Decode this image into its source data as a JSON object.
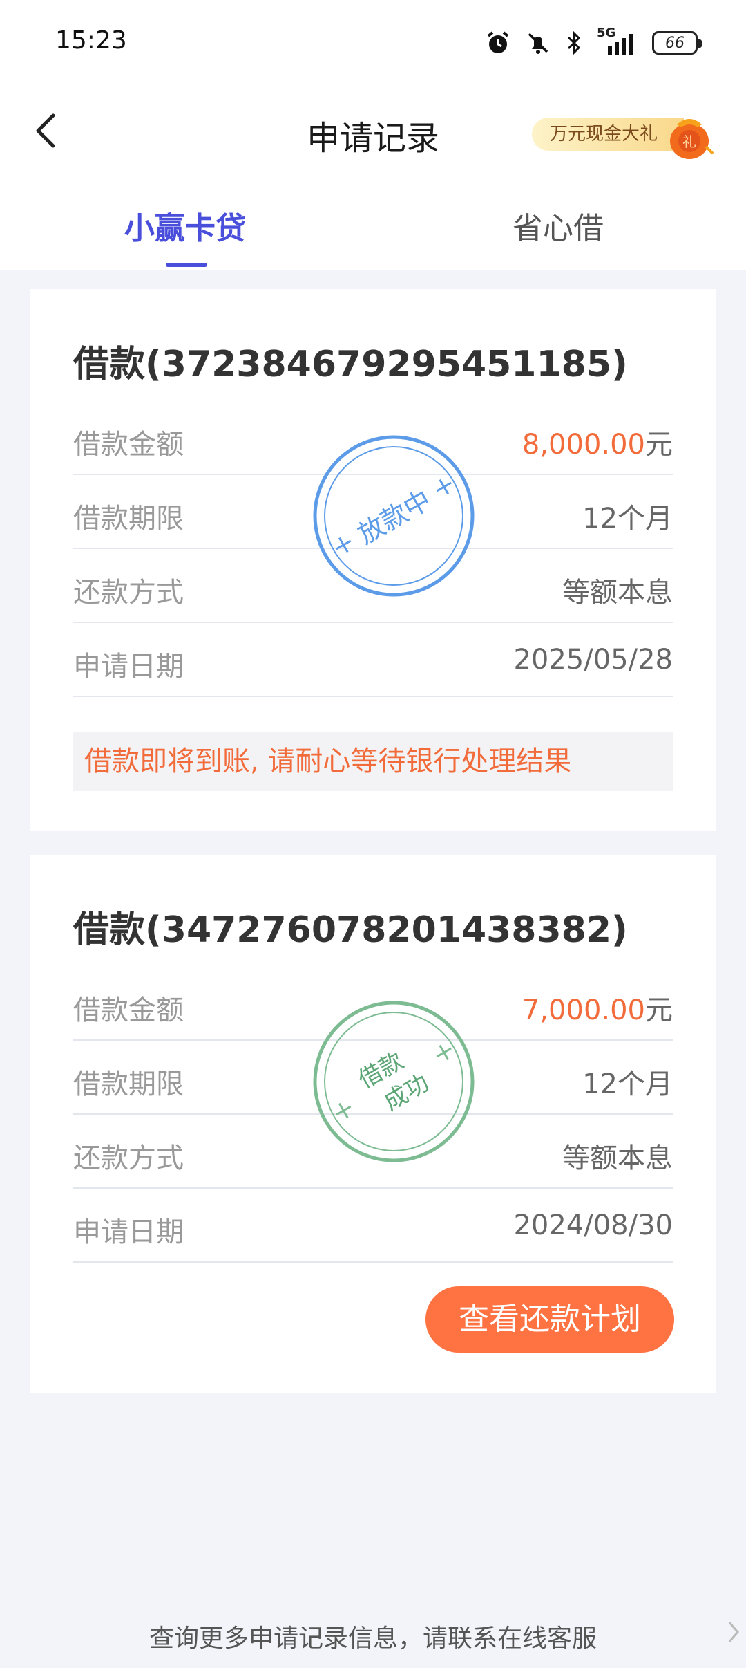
{
  "status_bar": {
    "time": "15:23",
    "network": "5G",
    "battery": "66",
    "icons": [
      "alarm-icon",
      "silent-bell-icon",
      "bluetooth-icon",
      "signal-icon",
      "battery-icon"
    ]
  },
  "header": {
    "title": "申请记录",
    "back_icon": "chevron-left-icon",
    "promo_label": "万元现金大礼",
    "promo_bag_text": "礼"
  },
  "tabs": [
    {
      "label": "小赢卡贷",
      "active": true
    },
    {
      "label": "省心借",
      "active": false
    }
  ],
  "colors": {
    "accent": "#4a4fdb",
    "amount": "#f26b3a",
    "button": "#ff7342",
    "stamp_pending": "#5b9be8",
    "stamp_success": "#7dbb92"
  },
  "loans": [
    {
      "title": "借款(372384679295451185)",
      "rows": [
        {
          "label": "借款金额",
          "amount": "8,000.00",
          "unit": "元"
        },
        {
          "label": "借款期限",
          "value": "12个月"
        },
        {
          "label": "还款方式",
          "value": "等额本息"
        },
        {
          "label": "申请日期",
          "value": "2025/05/28"
        }
      ],
      "stamp": "放款中",
      "notice": "借款即将到账, 请耐心等待银行处理结果"
    },
    {
      "title": "借款(347276078201438382)",
      "rows": [
        {
          "label": "借款金额",
          "amount": "7,000.00",
          "unit": "元"
        },
        {
          "label": "借款期限",
          "value": "12个月"
        },
        {
          "label": "还款方式",
          "value": "等额本息"
        },
        {
          "label": "申请日期",
          "value": "2024/08/30"
        }
      ],
      "stamp_line1": "借款",
      "stamp_line2": "成功",
      "button": "查看还款计划"
    }
  ],
  "footer": {
    "text": "查询更多申请记录信息，请联系在线客服"
  }
}
